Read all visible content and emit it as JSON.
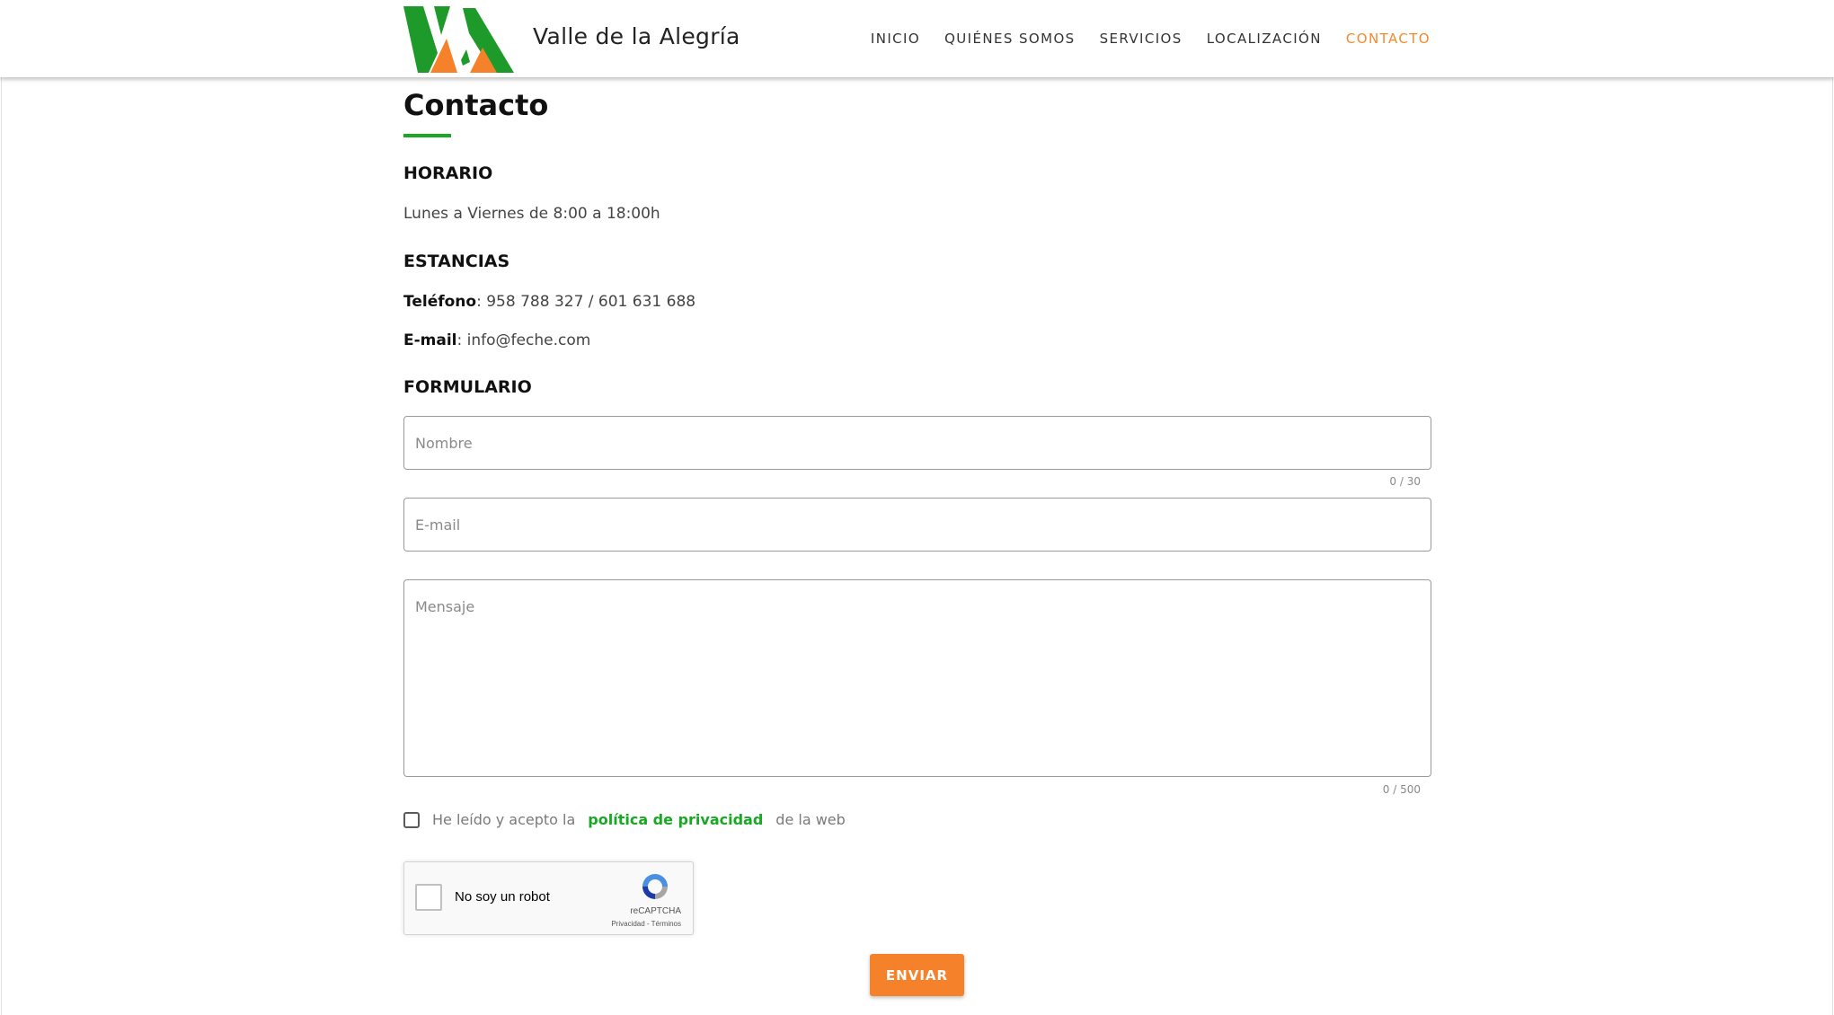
{
  "header": {
    "brand": "Valle de la Alegría",
    "nav": [
      {
        "label": "INICIO"
      },
      {
        "label": "QUIÉNES SOMOS"
      },
      {
        "label": "SERVICIOS"
      },
      {
        "label": "LOCALIZACIÓN"
      },
      {
        "label": "CONTACTO",
        "active": true
      }
    ]
  },
  "page": {
    "title": "Contacto",
    "schedule": {
      "heading": "HORARIO",
      "text": "Lunes a Viernes de 8:00 a 18:00h"
    },
    "stays": {
      "heading": "ESTANCIAS",
      "phone_label": "Teléfono",
      "phone_value": "958 788 327 / 601 631 688",
      "email_label": "E-mail",
      "email_value": "info@feche.com"
    },
    "form": {
      "heading": "FORMULARIO",
      "name_placeholder": "Nombre",
      "name_counter": "0 / 30",
      "email_placeholder": "E-mail",
      "message_placeholder": "Mensaje",
      "message_counter": "0 / 500",
      "consent_prefix": "He leído y acepto la",
      "consent_link": "política de privacidad",
      "consent_suffix": "de la web",
      "submit_label": "ENVIAR"
    },
    "recaptcha": {
      "label": "No soy un robot",
      "brand": "reCAPTCHA",
      "links": "Privacidad - Términos"
    }
  },
  "colors": {
    "accent_orange": "#f58a2c",
    "accent_green": "#19a824",
    "logo_green": "#1e9a2a",
    "logo_orange": "#f5822b"
  }
}
